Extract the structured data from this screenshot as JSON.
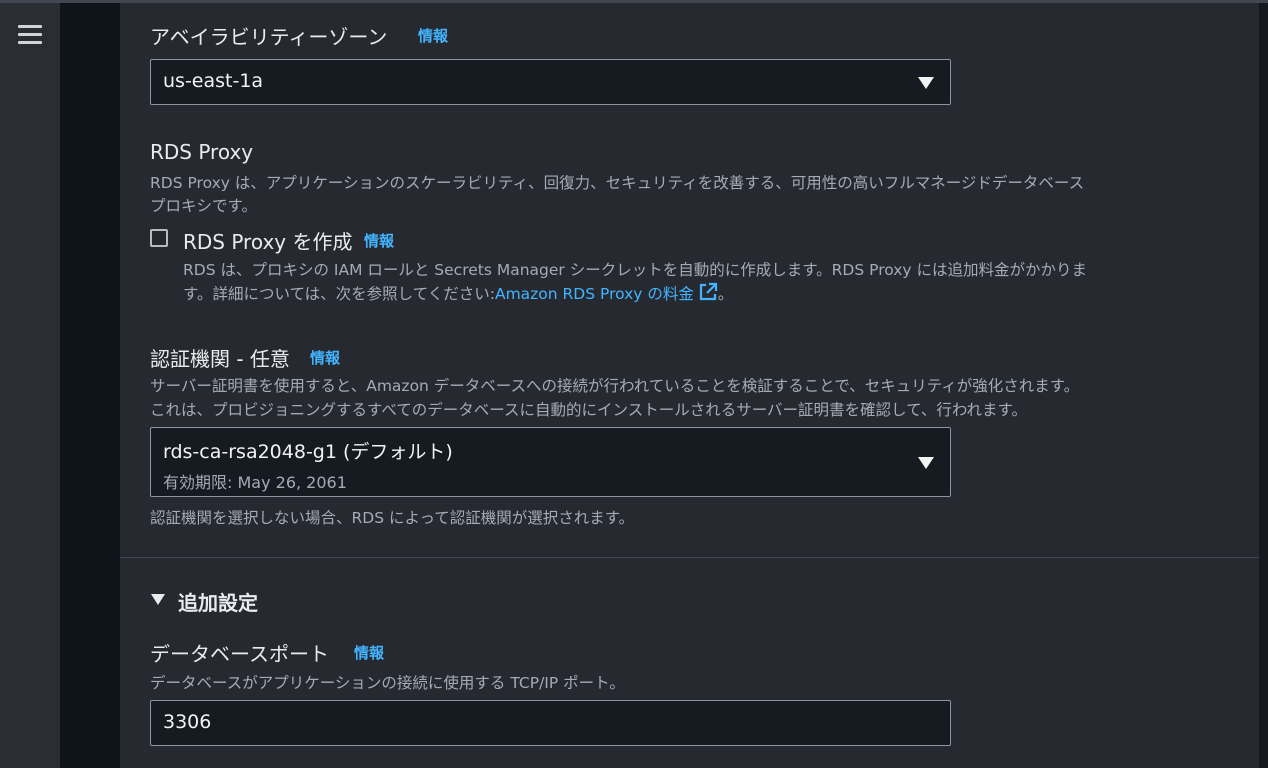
{
  "nav": {
    "menu_icon": "hamburger-menu-icon"
  },
  "availability_zone": {
    "label": "アベイラビリティーゾーン",
    "info": "情報",
    "value": "us-east-1a"
  },
  "rds_proxy": {
    "title": "RDS Proxy",
    "desc_line1": "RDS Proxy は、アプリケーションのスケーラビリティ、回復力、セキュリティを改善する、可用性の高いフルマネージドデータベース",
    "desc_line2": "プロキシです。",
    "checkbox_label": "RDS Proxy を作成",
    "info": "情報",
    "checkbox_checked": false,
    "note_line1": "RDS は、プロキシの IAM ロールと Secrets Manager シークレットを自動的に作成します。RDS Proxy には追加料金がかかりま",
    "note_line2_prefix": "す。詳細については、次を参照してください:",
    "note_link": "Amazon RDS Proxy の料金",
    "note_suffix": "。",
    "external_icon": "external-link-icon"
  },
  "cert_authority": {
    "label": "認証機関 - 任意",
    "info": "情報",
    "desc_line1": "サーバー証明書を使用すると、Amazon データベースへの接続が行われていることを検証することで、セキュリティが強化されます。",
    "desc_line2": "これは、プロビジョニングするすべてのデータベースに自動的にインストールされるサーバー証明書を確認して、行われます。",
    "value": "rds-ca-rsa2048-g1 (デフォルト)",
    "subvalue": "有効期限: May 26, 2061",
    "help": "認証機関を選択しない場合、RDS によって認証機関が選択されます。"
  },
  "additional": {
    "title": "追加設定",
    "port_label": "データベースポート",
    "info": "情報",
    "port_desc": "データベースがアプリケーションの接続に使用する TCP/IP ポート。",
    "port_value": "3306"
  },
  "colors": {
    "link": "#42b4ff",
    "panel": "#262a30",
    "input_bg": "#161b22"
  }
}
